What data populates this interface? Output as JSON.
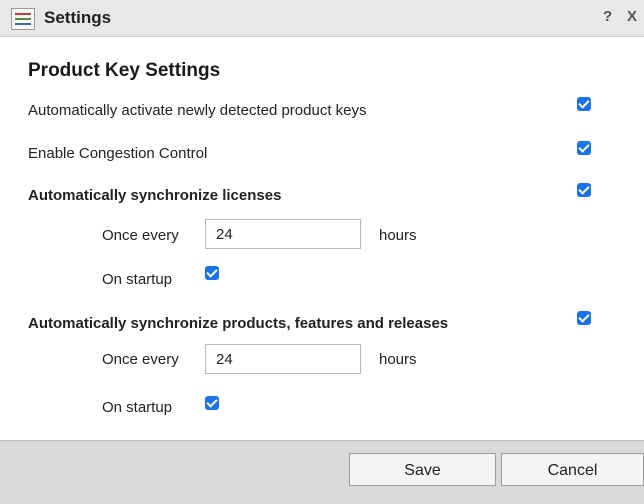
{
  "window": {
    "title": "Settings",
    "help_glyph": "?",
    "close_glyph": "X",
    "app_icon": "settings-app-icon"
  },
  "section_title": "Product Key Settings",
  "options": [
    {
      "label": "Automatically activate newly detected product keys",
      "checked": true
    },
    {
      "label": "Enable Congestion Control",
      "checked": true
    }
  ],
  "sync_licenses": {
    "label": "Automatically synchronize licenses",
    "checked": true,
    "interval_label": "Once every",
    "interval_value": "24",
    "interval_unit": "hours",
    "startup_label": "On startup",
    "startup_checked": true
  },
  "sync_products": {
    "label": "Automatically synchronize products, features and releases",
    "checked": true,
    "interval_label": "Once every",
    "interval_value": "24",
    "interval_unit": "hours",
    "startup_label": "On startup",
    "startup_checked": true
  },
  "footer": {
    "save_label": "Save",
    "cancel_label": "Cancel"
  },
  "colors": {
    "accent": "#1a73e8",
    "titlebar": "#e8e8e8",
    "footer": "#d9d9d9"
  }
}
